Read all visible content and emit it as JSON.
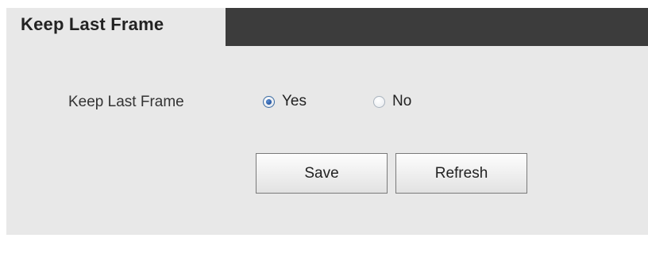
{
  "header": {
    "title": "Keep Last Frame"
  },
  "form": {
    "field_label": "Keep Last Frame",
    "options": [
      {
        "label": "Yes",
        "checked": true
      },
      {
        "label": "No",
        "checked": false
      }
    ]
  },
  "buttons": {
    "save_label": "Save",
    "refresh_label": "Refresh"
  },
  "colors": {
    "header_bar": "#3c3c3c",
    "panel": "#e8e8e8",
    "radio_selected": "#1f4f99"
  }
}
